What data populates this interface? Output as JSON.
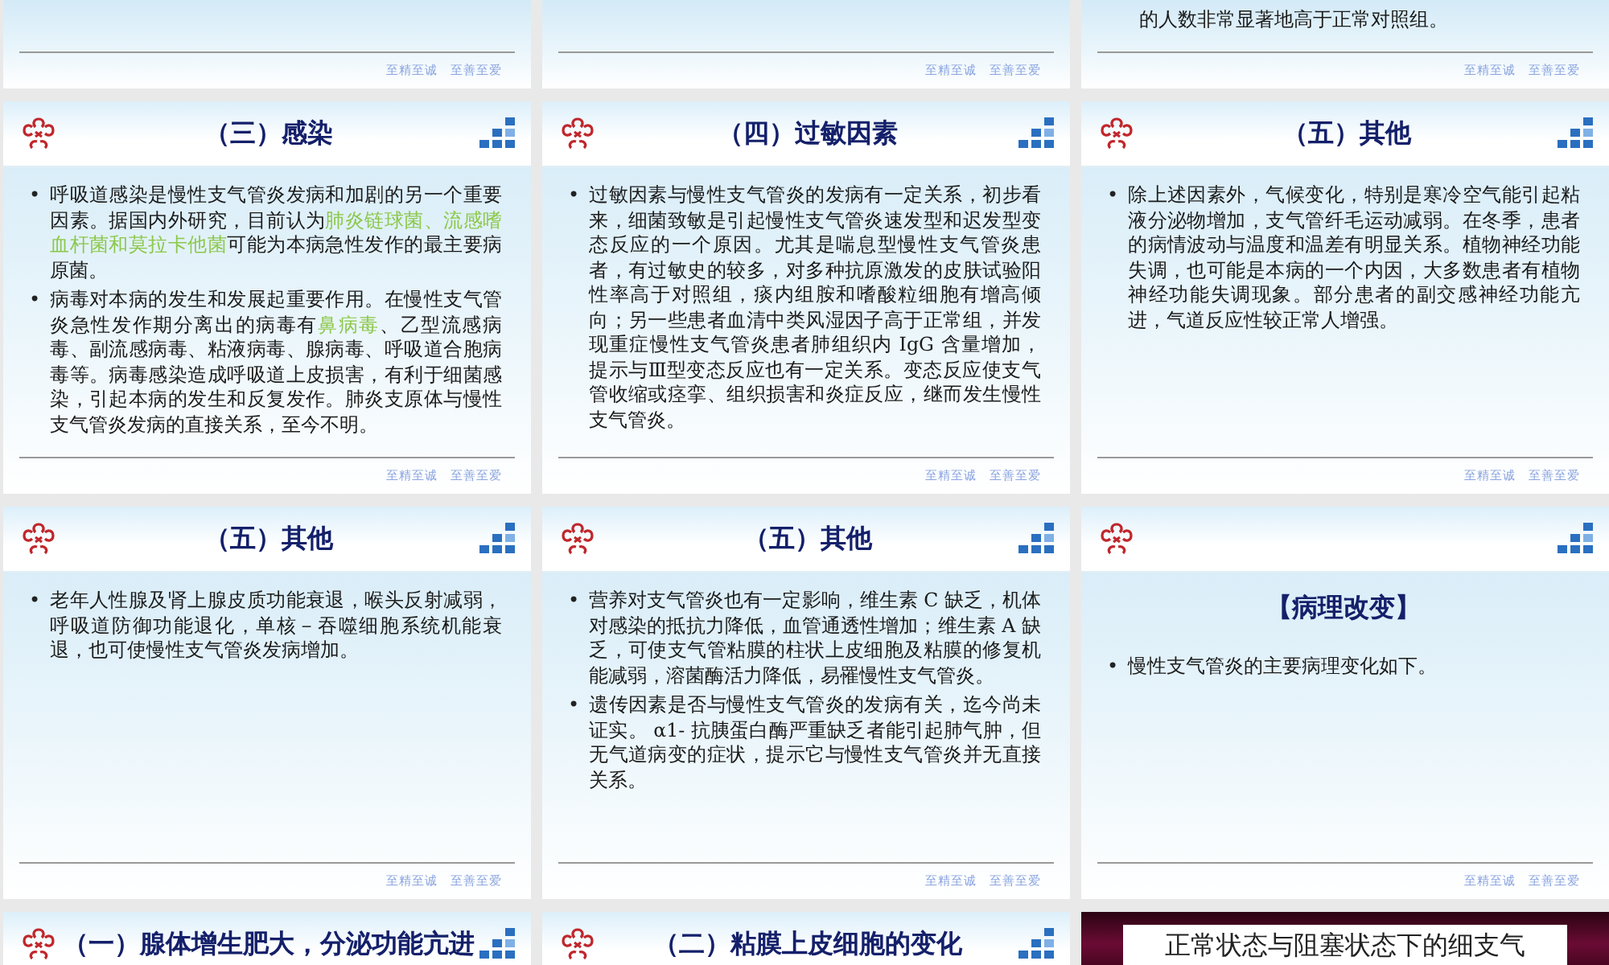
{
  "rows": [
    {
      "kind": "tail",
      "slides": [
        {
          "footer": [
            "至精至诚",
            "至善至爱"
          ]
        },
        {
          "footer": [
            "至精至诚",
            "至善至爱"
          ]
        },
        {
          "lines": [
            "的人数非常显著地高于正常对照组。"
          ],
          "footer": [
            "至精至诚",
            "至善至爱"
          ]
        }
      ]
    },
    {
      "kind": "full",
      "slides": [
        {
          "kind": "standard",
          "title": "（三）感染",
          "bullets": [
            {
              "marker": "•",
              "segments": [
                {
                  "text": "呼吸道感染是慢性支气管炎发病和加剧的另一个重要因素。据国内外研究，目前认为",
                  "highlight": false
                },
                {
                  "text": "肺炎链球菌、流感嗜血杆菌和莫拉卡他菌",
                  "highlight": true
                },
                {
                  "text": "可能为本病急性发作的最主要病原菌。",
                  "highlight": false
                }
              ]
            },
            {
              "marker": "•",
              "segments": [
                {
                  "text": "病毒对本病的发生和发展起重要作用。在慢性支气管炎急性发作期分离出的病毒有",
                  "highlight": false
                },
                {
                  "text": "鼻病毒",
                  "highlight": true
                },
                {
                  "text": "、乙型流感病毒、副流感病毒、粘液病毒、腺病毒、呼吸道合胞病毒等。病毒感染造成呼吸道上皮损害，有利于细菌感染，引起本病的发生和反复发作。肺炎支原体与慢性支气管炎发病的直接关系，至今不明。",
                  "highlight": false
                }
              ]
            }
          ],
          "footer": [
            "至精至诚",
            "至善至爱"
          ]
        },
        {
          "kind": "standard",
          "title": "（四）过敏因素",
          "bullets": [
            {
              "marker": "•",
              "segments": [
                {
                  "text": "过敏因素与慢性支气管炎的发病有一定关系，初步看来，细菌致敏是引起慢性支气管炎速发型和迟发型变态反应的一个原因。尤其是喘息型慢性支气管炎患者，有过敏史的较多，对多种抗原激发的皮肤试验阳性率高于对照组，痰内组胺和嗜酸粒细胞有增高倾向；另一些患者血清中类风湿因子高于正常组，并发现重症慢性支气管炎患者肺组织内 IgG 含量增加，提示与Ⅲ型变态反应也有一定关系。变态反应使支气管收缩或痉挛、组织损害和炎症反应，继而发生慢性支气管炎。",
                  "highlight": false
                }
              ]
            }
          ],
          "footer": [
            "至精至诚",
            "至善至爱"
          ]
        },
        {
          "kind": "standard",
          "title": "（五）其他",
          "bullets": [
            {
              "marker": "•",
              "segments": [
                {
                  "text": "除上述因素外，气候变化，特别是寒冷空气能引起粘液分泌物增加，支气管纤毛运动减弱。在冬季，患者的病情波动与温度和温差有明显关系。植物神经功能失调，也可能是本病的一个内因，大多数患者有植物神经功能失调现象。部分患者的副交感神经功能亢进，气道反应性较正常人增强。",
                  "highlight": false
                }
              ]
            }
          ],
          "footer": [
            "至精至诚",
            "至善至爱"
          ]
        }
      ]
    },
    {
      "kind": "full",
      "slides": [
        {
          "kind": "standard",
          "title": "（五）其他",
          "bullets": [
            {
              "marker": "•",
              "segments": [
                {
                  "text": "老年人性腺及肾上腺皮质功能衰退，喉头反射减弱，呼吸道防御功能退化，单核－吞噬细胞系统机能衰退，也可使慢性支气管炎发病增加。",
                  "highlight": false
                }
              ]
            }
          ],
          "footer": [
            "至精至诚",
            "至善至爱"
          ]
        },
        {
          "kind": "standard",
          "title": "（五）其他",
          "bullets": [
            {
              "marker": "•",
              "segments": [
                {
                  "text": "营养对支气管炎也有一定影响，维生素 C 缺乏，机体对感染的抵抗力降低，血管通透性增加；维生素 A 缺乏，可使支气管粘膜的柱状上皮细胞及粘膜的修复机能减弱，溶菌酶活力降低，易罹慢性支气管炎。",
                  "highlight": false
                }
              ]
            },
            {
              "marker": "•",
              "segments": [
                {
                  "text": "遗传因素是否与慢性支气管炎的发病有关，迄今尚未证实。 α1- 抗胰蛋白酶严重缺乏者能引起肺气肿，但无气道病变的症状，提示它与慢性支气管炎并无直接关系。",
                  "highlight": false
                }
              ]
            }
          ],
          "footer": [
            "至精至诚",
            "至善至爱"
          ]
        },
        {
          "kind": "section",
          "title": "【病理改变】",
          "bullets": [
            {
              "marker": "•",
              "segments": [
                {
                  "text": "慢性支气管炎的主要病理变化如下。",
                  "highlight": false
                }
              ]
            }
          ],
          "footer": [
            "至精至诚",
            "至善至爱"
          ]
        }
      ]
    },
    {
      "kind": "head",
      "slides": [
        {
          "kind": "light",
          "title": "（一）腺体增生肥大，分泌功能亢进"
        },
        {
          "kind": "light",
          "title": "（二）粘膜上皮细胞的变化"
        },
        {
          "kind": "dark",
          "title": "正常状态与阻塞状态下的细支气"
        }
      ]
    }
  ]
}
